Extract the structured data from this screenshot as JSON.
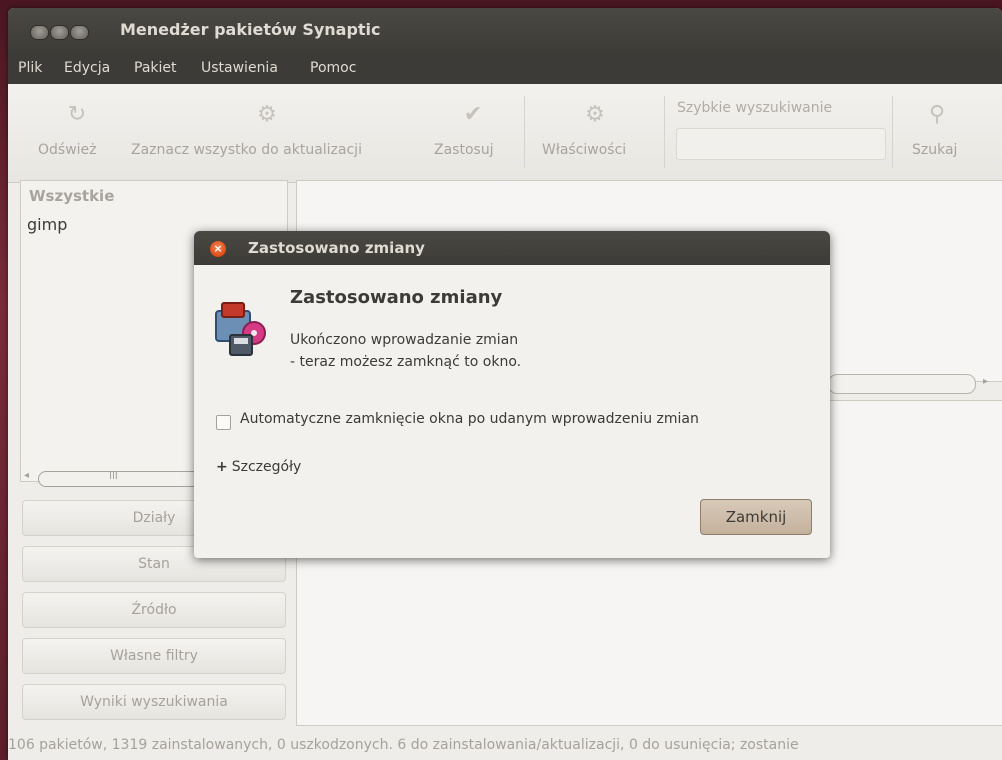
{
  "window": {
    "title": "Menedżer pakietów Synaptic"
  },
  "menubar": {
    "items": [
      "Plik",
      "Edycja",
      "Pakiet",
      "Ustawienia",
      "Pomoc"
    ]
  },
  "toolbar": {
    "refresh": "Odśwież",
    "mark_all": "Zaznacz wszystko do aktualizacji",
    "apply": "Zastosuj",
    "properties": "Właściwości",
    "quick_search_label": "Szybkie wyszukiwanie",
    "quick_search_value": "",
    "search": "Szukaj"
  },
  "left_panel": {
    "header": "Wszystkie",
    "items": [
      "gimp"
    ],
    "scroll_grip": "III"
  },
  "filter_buttons": [
    "Działy",
    "Stan",
    "Źródło",
    "Własne filtry",
    "Wyniki wyszukiwania"
  ],
  "status_bar": {
    "text": "106 pakietów, 1319 zainstalowanych, 0 uszkodzonych. 6 do zainstalowania/aktualizacji, 0 do usunięcia; zostanie"
  },
  "dialog": {
    "title": "Zastosowano zmiany",
    "heading": "Zastosowano zmiany",
    "message_line1": "Ukończono wprowadzanie zmian",
    "message_line2": "- teraz możesz zamknąć to okno.",
    "checkbox_label": "Automatyczne zamknięcie okna po udanym wprowadzeniu zmian",
    "checkbox_checked": false,
    "expander_sign": "+",
    "expander_label": "Szczegóły",
    "close_button": "Zamknij"
  },
  "colors": {
    "titlebar": "#3c3b37",
    "accent_button": "#c3b19c",
    "close_icon": "#df4b16"
  }
}
